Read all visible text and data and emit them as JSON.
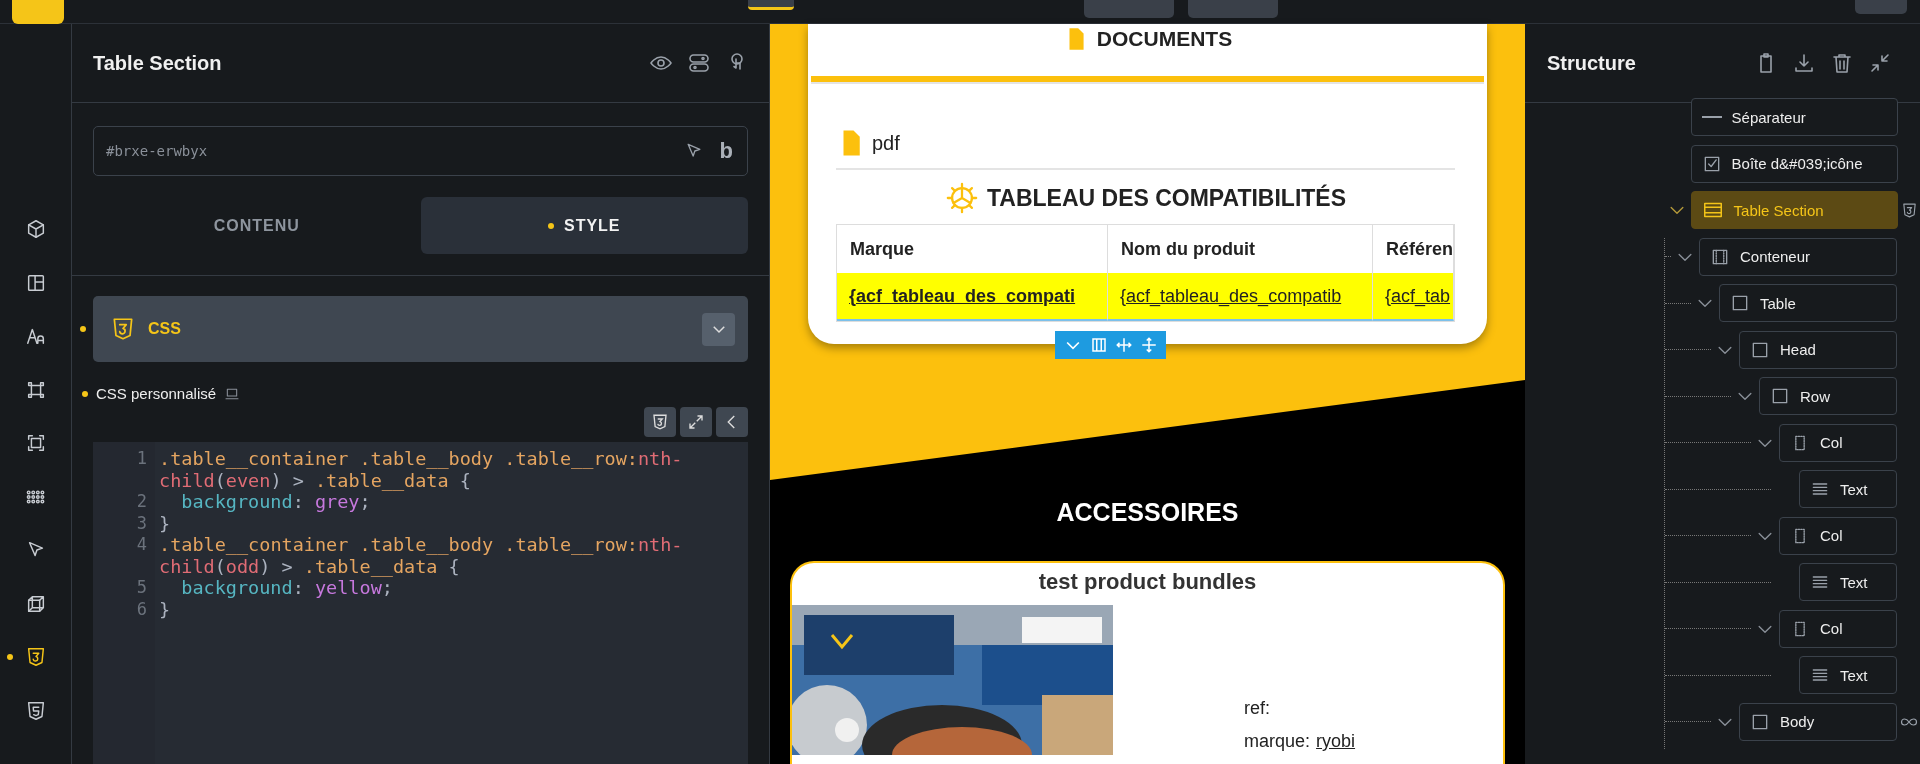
{
  "top_bar": {
    "tools": [
      {
        "selected": true
      }
    ]
  },
  "rail": [
    {
      "kind": "cube",
      "selected": false,
      "modified": false
    },
    {
      "kind": "layout",
      "selected": false,
      "modified": false
    },
    {
      "kind": "typography",
      "selected": false,
      "modified": false
    },
    {
      "kind": "frame",
      "selected": false,
      "modified": false
    },
    {
      "kind": "frame-alt",
      "selected": false,
      "modified": false
    },
    {
      "kind": "dots",
      "selected": false,
      "modified": false
    },
    {
      "kind": "cursor",
      "selected": false,
      "modified": false
    },
    {
      "kind": "box",
      "selected": false,
      "modified": false
    },
    {
      "kind": "css",
      "selected": true,
      "modified": true
    },
    {
      "kind": "html",
      "selected": false,
      "modified": false
    }
  ],
  "panel": {
    "title": "Table Section",
    "selector_field": {
      "placeholder": "#brxe-erwbyx",
      "logo_char": "b"
    },
    "tabs": [
      {
        "label": "CONTENU",
        "selected": false,
        "modified": false
      },
      {
        "label": "STYLE",
        "selected": true,
        "modified": true
      }
    ],
    "accordion": {
      "label": "CSS",
      "expanded": true,
      "modified": true
    },
    "custom_css": {
      "label": "CSS personnalisé",
      "modified": true
    },
    "code": [
      {
        "number": "1",
        "rows": [
          {
            "tokens": [
              {
                "text": ".table__container .table__body .table__row:",
                "kind": "selector"
              },
              {
                "text": "nth-",
                "kind": "pseudo"
              }
            ]
          },
          {
            "tokens": [
              {
                "text": "child",
                "kind": "pseudo"
              },
              {
                "text": "(",
                "kind": "punct"
              },
              {
                "text": "even",
                "kind": "pseudo"
              },
              {
                "text": ") > ",
                "kind": "punct"
              },
              {
                "text": ".table__data",
                "kind": "selector"
              },
              {
                "text": " {",
                "kind": "punct"
              }
            ]
          }
        ]
      },
      {
        "number": "2",
        "rows": [
          {
            "tokens": [
              {
                "text": "background",
                "kind": "property"
              },
              {
                "text": ": ",
                "kind": "punct"
              },
              {
                "text": "grey",
                "kind": "value"
              },
              {
                "text": ";",
                "kind": "punct"
              }
            ]
          }
        ]
      },
      {
        "number": "3",
        "rows": [
          {
            "tokens": [
              {
                "text": "}",
                "kind": "punct"
              }
            ]
          }
        ]
      },
      {
        "number": "4",
        "rows": [
          {
            "tokens": [
              {
                "text": ".table__container .table__body .table__row:",
                "kind": "selector"
              },
              {
                "text": "nth-",
                "kind": "pseudo"
              }
            ]
          },
          {
            "tokens": [
              {
                "text": "child",
                "kind": "pseudo"
              },
              {
                "text": "(",
                "kind": "punct"
              },
              {
                "text": "odd",
                "kind": "pseudo"
              },
              {
                "text": ") > ",
                "kind": "punct"
              },
              {
                "text": ".table__data",
                "kind": "selector"
              },
              {
                "text": " {",
                "kind": "punct"
              }
            ]
          }
        ]
      },
      {
        "number": "5",
        "rows": [
          {
            "tokens": [
              {
                "text": "background",
                "kind": "property"
              },
              {
                "text": ": ",
                "kind": "punct"
              },
              {
                "text": "yellow",
                "kind": "value"
              },
              {
                "text": ";",
                "kind": "punct"
              }
            ]
          }
        ]
      },
      {
        "number": "6",
        "rows": [
          {
            "tokens": [
              {
                "text": "}",
                "kind": "punct"
              }
            ]
          }
        ]
      }
    ]
  },
  "canvas": {
    "documents_heading": "DOCUMENTS",
    "file_label": "pdf",
    "table_title": "TABLEAU DES COMPATIBILITÉS",
    "table": {
      "columns": [
        "Marque",
        "Nom du produit",
        "Référen"
      ],
      "rows": [
        [
          "{acf_tableau_des_compati",
          "{acf_tableau_des_compatib",
          "{acf_tab"
        ]
      ]
    },
    "section_heading": "ACCESSOIRES",
    "product": {
      "title": "test product bundles",
      "ref_label": "ref:",
      "brand_label": "marque:",
      "brand_link": "ryobi"
    }
  },
  "structure": {
    "title": "Structure",
    "tree": [
      {
        "label": "Séparateur",
        "kind": "separator",
        "selected": false
      },
      {
        "label": "Boîte d&#039;icône",
        "kind": "icon-box",
        "selected": false
      },
      {
        "label": "Table Section",
        "kind": "section",
        "selected": true,
        "expanded": true,
        "has_custom_css": true,
        "children": [
          {
            "label": "Conteneur",
            "kind": "container",
            "selected": false,
            "expanded": true,
            "children": [
              {
                "label": "Table",
                "kind": "block",
                "selected": false,
                "expanded": true,
                "children": [
                  {
                    "label": "Head",
                    "kind": "block",
                    "selected": false,
                    "expanded": true,
                    "children": [
                      {
                        "label": "Row",
                        "kind": "block",
                        "selected": false,
                        "expanded": true,
                        "children": [
                          {
                            "label": "Col",
                            "kind": "column",
                            "selected": false,
                            "expanded": true,
                            "children": [
                              {
                                "label": "Text",
                                "kind": "text",
                                "selected": false
                              }
                            ]
                          },
                          {
                            "label": "Col",
                            "kind": "column",
                            "selected": false,
                            "expanded": true,
                            "children": [
                              {
                                "label": "Text",
                                "kind": "text",
                                "selected": false
                              }
                            ]
                          },
                          {
                            "label": "Col",
                            "kind": "column",
                            "selected": false,
                            "expanded": true,
                            "children": [
                              {
                                "label": "Text",
                                "kind": "text",
                                "selected": false
                              }
                            ]
                          }
                        ]
                      }
                    ]
                  },
                  {
                    "label": "Body",
                    "kind": "block",
                    "selected": false,
                    "expanded": true,
                    "looping": true
                  }
                ]
              }
            ]
          }
        ]
      }
    ]
  }
}
